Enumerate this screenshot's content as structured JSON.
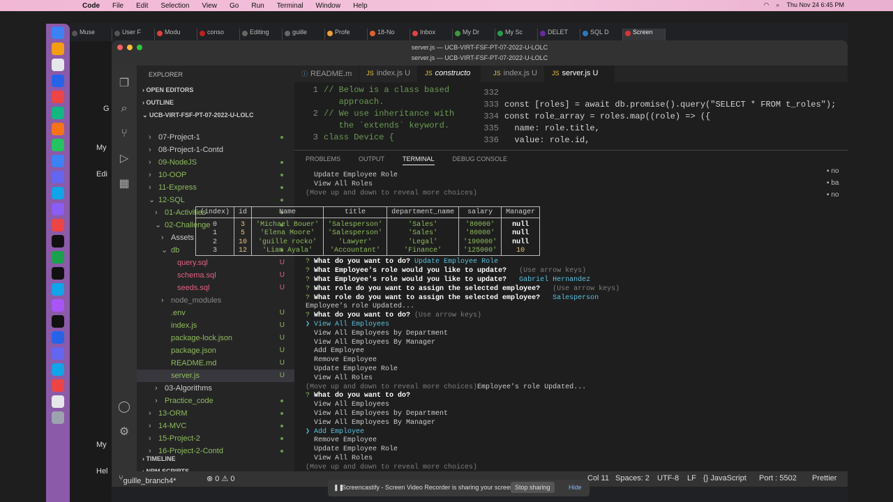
{
  "menubar": {
    "app": "Code",
    "items": [
      "File",
      "Edit",
      "Selection",
      "View",
      "Go",
      "Run",
      "Terminal",
      "Window",
      "Help"
    ],
    "datetime": "Thu Nov 24  6:45 PM"
  },
  "browser_tabs": [
    {
      "label": "Muse",
      "color": "#555"
    },
    {
      "label": "User F",
      "color": "#555"
    },
    {
      "label": "Modu",
      "color": "#e04040"
    },
    {
      "label": "conso",
      "color": "#c02020"
    },
    {
      "label": "Editing",
      "color": "#666"
    },
    {
      "label": "guille",
      "color": "#666"
    },
    {
      "label": "Profe",
      "color": "#f0a030"
    },
    {
      "label": "18-No",
      "color": "#e06030"
    },
    {
      "label": "Inbox",
      "color": "#d44"
    },
    {
      "label": "My Dr",
      "color": "#3a9a3a"
    },
    {
      "label": "My Sc",
      "color": "#2a9a4a"
    },
    {
      "label": "DELET",
      "color": "#6a2aa0"
    },
    {
      "label": "SQL D",
      "color": "#2a7ac0"
    },
    {
      "label": "Screen",
      "color": "#d33"
    }
  ],
  "vscode": {
    "title": "server.js — UCB-VIRT-FSF-PT-07-2022-U-LOLC",
    "subtitle": "server.js — UCB-VIRT-FSF-PT-07-2022-U-LOLC",
    "explorer_title": "EXPLORER",
    "sections": {
      "open_editors": "OPEN EDITORS",
      "outline": "OUTLINE",
      "root": "UCB-VIRT-FSF-PT-07-2022-U-LOLC",
      "timeline": "TIMELINE",
      "npm": "NPM SCRIPTS"
    },
    "tree": [
      {
        "label": "07-Project-1",
        "indent": 1,
        "arrow": "›",
        "color": "#ccc",
        "status": "dot"
      },
      {
        "label": "08-Project-1-Contd",
        "indent": 1,
        "arrow": "›",
        "color": "#ccc",
        "status": ""
      },
      {
        "label": "09-NodeJS",
        "indent": 1,
        "arrow": "›",
        "color": "#8fbc5c",
        "status": "dot"
      },
      {
        "label": "10-OOP",
        "indent": 1,
        "arrow": "›",
        "color": "#8fbc5c",
        "status": "dot"
      },
      {
        "label": "11-Express",
        "indent": 1,
        "arrow": "›",
        "color": "#8fbc5c",
        "status": "dot"
      },
      {
        "label": "12-SQL",
        "indent": 1,
        "arrow": "⌄",
        "color": "#8fbc5c",
        "status": "dot"
      },
      {
        "label": "01-Activities",
        "indent": 2,
        "arrow": "›",
        "color": "#8fbc5c",
        "status": "dot"
      },
      {
        "label": "02-Challenge",
        "indent": 2,
        "arrow": "⌄",
        "color": "#8fbc5c",
        "status": "dot"
      },
      {
        "label": "Assets",
        "indent": 3,
        "arrow": "›",
        "color": "#ccc",
        "status": ""
      },
      {
        "label": "db",
        "indent": 3,
        "arrow": "⌄",
        "color": "#8fbc5c",
        "status": "dot"
      },
      {
        "label": "query.sql",
        "indent": 4,
        "arrow": "",
        "color": "#e06080",
        "status": "U"
      },
      {
        "label": "schema.sql",
        "indent": 4,
        "arrow": "",
        "color": "#e06080",
        "status": "U"
      },
      {
        "label": "seeds.sql",
        "indent": 4,
        "arrow": "",
        "color": "#e06080",
        "status": "U"
      },
      {
        "label": "node_modules",
        "indent": 3,
        "arrow": "›",
        "color": "#888",
        "status": ""
      },
      {
        "label": ".env",
        "indent": 3,
        "arrow": "",
        "color": "#8fbc5c",
        "status": "U"
      },
      {
        "label": "index.js",
        "indent": 3,
        "arrow": "",
        "color": "#8fbc5c",
        "status": "U"
      },
      {
        "label": "package-lock.json",
        "indent": 3,
        "arrow": "",
        "color": "#8fbc5c",
        "status": "U"
      },
      {
        "label": "package.json",
        "indent": 3,
        "arrow": "",
        "color": "#8fbc5c",
        "status": "U"
      },
      {
        "label": "README.md",
        "indent": 3,
        "arrow": "",
        "color": "#8fbc5c",
        "status": "U"
      },
      {
        "label": "server.js",
        "indent": 3,
        "arrow": "",
        "color": "#8fbc5c",
        "status": "U",
        "selected": true
      },
      {
        "label": "03-Algorithms",
        "indent": 2,
        "arrow": "›",
        "color": "#ccc",
        "status": ""
      },
      {
        "label": "Practice_code",
        "indent": 2,
        "arrow": "›",
        "color": "#8fbc5c",
        "status": "dot"
      },
      {
        "label": "13-ORM",
        "indent": 1,
        "arrow": "›",
        "color": "#8fbc5c",
        "status": "dot"
      },
      {
        "label": "14-MVC",
        "indent": 1,
        "arrow": "›",
        "color": "#8fbc5c",
        "status": "dot"
      },
      {
        "label": "15-Project-2",
        "indent": 1,
        "arrow": "›",
        "color": "#8fbc5c",
        "status": "dot"
      },
      {
        "label": "16-Project-2-Contd",
        "indent": 1,
        "arrow": "›",
        "color": "#8fbc5c",
        "status": "dot"
      }
    ],
    "editor_tabs_left": [
      "README.m",
      "index.js",
      "constructo"
    ],
    "editor_tabs_right": [
      "index.js",
      "server.js"
    ],
    "tab_status": "U",
    "left_code": [
      {
        "n": "1",
        "t": "// Below is a class based"
      },
      {
        "n": "",
        "t": "   approach."
      },
      {
        "n": "2",
        "t": "// We use inheritance with"
      },
      {
        "n": "",
        "t": "   the `extends` keyword."
      },
      {
        "n": "3",
        "t": "class Device {"
      }
    ],
    "right_code": [
      {
        "n": "332",
        "t": ""
      },
      {
        "n": "333",
        "t": "const [roles] = await db.promise().query(\"SELECT * FROM t_roles\");"
      },
      {
        "n": "334",
        "t": "const role_array = roles.map((role) => ({"
      },
      {
        "n": "335",
        "t": "  name: role.title,"
      },
      {
        "n": "336",
        "t": "  value: role.id,"
      }
    ],
    "panel_tabs": [
      "PROBLEMS",
      "OUTPUT",
      "TERMINAL",
      "DEBUG CONSOLE"
    ],
    "terminal_top": [
      {
        "c": "",
        "t": "  Update Employee Role"
      },
      {
        "c": "",
        "t": "  View All Roles"
      },
      {
        "c": "g",
        "t": "(Move up and down to reveal more choices)"
      }
    ],
    "table": {
      "headers": [
        "(index)",
        "id",
        "Name",
        "title",
        "department_name",
        "salary",
        "Manager"
      ],
      "rows": [
        [
          "0",
          "3",
          "'Michael Bouer'",
          "'Salesperson'",
          "'Sales'",
          "'80000'",
          "null"
        ],
        [
          "1",
          "5",
          "'Elena Moore'",
          "'Salesperson'",
          "'Sales'",
          "'80000'",
          "null"
        ],
        [
          "2",
          "10",
          "'guille rocko'",
          "'Lawyer'",
          "'Legal'",
          "'190000'",
          "null"
        ],
        [
          "3",
          "12",
          "'Liam  Ayala'",
          "'Accountant'",
          "'Finance'",
          "'125000'",
          "10"
        ]
      ]
    },
    "terminal_lines": [
      [
        {
          "c": "gr",
          "t": "? "
        },
        {
          "c": "bw",
          "t": "What do you want to do? "
        },
        {
          "c": "cy",
          "t": "Update Employee Role"
        }
      ],
      [
        {
          "c": "gr",
          "t": "? "
        },
        {
          "c": "bw",
          "t": "What Employee's role would you like to update? "
        },
        {
          "c": "g",
          "t": "  (Use arrow keys)"
        }
      ],
      [
        {
          "c": "gr",
          "t": "? "
        },
        {
          "c": "bw",
          "t": "What Employee's role would you like to update?  "
        },
        {
          "c": "cy",
          "t": " Gabriel Hernandez"
        }
      ],
      [
        {
          "c": "gr",
          "t": "? "
        },
        {
          "c": "bw",
          "t": "What role do you want to assign the selected employee? "
        },
        {
          "c": "g",
          "t": "  (Use arrow keys)"
        }
      ],
      [
        {
          "c": "gr",
          "t": "? "
        },
        {
          "c": "bw",
          "t": "What role do you want to assign the selected employee?  "
        },
        {
          "c": "cy",
          "t": " Salesperson"
        }
      ],
      [
        {
          "c": "",
          "t": "Employee's role Updated..."
        }
      ],
      [
        {
          "c": "gr",
          "t": "? "
        },
        {
          "c": "bw",
          "t": "What do you want to do? "
        },
        {
          "c": "g",
          "t": "(Use arrow keys)"
        }
      ],
      [
        {
          "c": "cy",
          "t": "❯ View All Employees"
        }
      ],
      [
        {
          "c": "",
          "t": "  View All Employees by Department"
        }
      ],
      [
        {
          "c": "",
          "t": "  View All Employees By Manager"
        }
      ],
      [
        {
          "c": "",
          "t": "  Add Employee"
        }
      ],
      [
        {
          "c": "",
          "t": "  Remove Employee"
        }
      ],
      [
        {
          "c": "",
          "t": "  Update Employee Role"
        }
      ],
      [
        {
          "c": "",
          "t": "  View All Roles"
        }
      ],
      [
        {
          "c": "g",
          "t": "(Move up and down to reveal more choices)"
        },
        {
          "c": "",
          "t": "Employee's role Updated..."
        }
      ],
      [
        {
          "c": "gr",
          "t": "? "
        },
        {
          "c": "bw",
          "t": "What do you want to do?"
        }
      ],
      [
        {
          "c": "",
          "t": "  View All Employees"
        }
      ],
      [
        {
          "c": "",
          "t": "  View All Employees by Department"
        }
      ],
      [
        {
          "c": "",
          "t": "  View All Employees By Manager"
        }
      ],
      [
        {
          "c": "cy",
          "t": "❯ Add Employee"
        }
      ],
      [
        {
          "c": "",
          "t": "  Remove Employee"
        }
      ],
      [
        {
          "c": "",
          "t": "  Update Employee Role"
        }
      ],
      [
        {
          "c": "",
          "t": "  View All Roles"
        }
      ],
      [
        {
          "c": "g",
          "t": "(Move up and down to reveal more choices)"
        }
      ]
    ],
    "status": {
      "branch": "guille_branch4*",
      "problems": "⊗ 0 ⚠ 0",
      "col": "Col 11",
      "spaces": "Spaces: 2",
      "encoding": "UTF-8",
      "eol": "LF",
      "language": "{} JavaScript",
      "port": "Port : 5502",
      "prettier": "Prettier"
    },
    "right_items": [
      "no",
      "ba",
      "no"
    ]
  },
  "share_bar": {
    "text": "Screencastify - Screen Video Recorder is sharing your screen.",
    "stop": "Stop sharing",
    "hide": "Hide"
  },
  "behind": [
    "G",
    "My",
    "Edi",
    "My",
    "Hel"
  ]
}
